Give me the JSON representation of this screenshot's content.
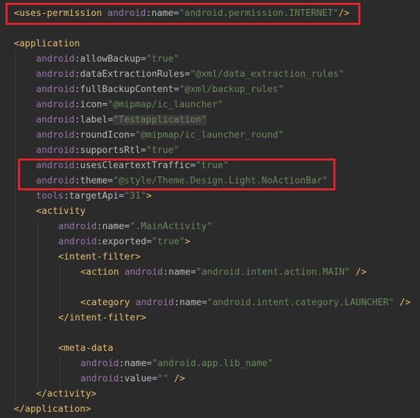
{
  "editor": {
    "highlight_color": "#e5232a",
    "lines": [
      {
        "indent": 0,
        "parts": [
          {
            "t": "<uses-permission",
            "c": "tag"
          },
          {
            "t": " ",
            "c": "punc"
          },
          {
            "t": "android",
            "c": "ns"
          },
          {
            "t": ":name",
            "c": "attr"
          },
          {
            "t": "=",
            "c": "punc"
          },
          {
            "t": "\"android.permission.INTERNET\"",
            "c": "val"
          },
          {
            "t": "/>",
            "c": "tag"
          }
        ]
      },
      {
        "indent": 0,
        "parts": []
      },
      {
        "indent": 0,
        "parts": [
          {
            "t": "<application",
            "c": "tag"
          }
        ]
      },
      {
        "indent": 1,
        "parts": [
          {
            "t": "android",
            "c": "ns"
          },
          {
            "t": ":allowBackup",
            "c": "attr"
          },
          {
            "t": "=",
            "c": "punc"
          },
          {
            "t": "\"true\"",
            "c": "val"
          }
        ]
      },
      {
        "indent": 1,
        "parts": [
          {
            "t": "android",
            "c": "ns"
          },
          {
            "t": ":dataExtractionRules",
            "c": "attr"
          },
          {
            "t": "=",
            "c": "punc"
          },
          {
            "t": "\"@xml/data_extraction_rules\"",
            "c": "val"
          }
        ]
      },
      {
        "indent": 1,
        "parts": [
          {
            "t": "android",
            "c": "ns"
          },
          {
            "t": ":fullBackupContent",
            "c": "attr"
          },
          {
            "t": "=",
            "c": "punc"
          },
          {
            "t": "\"@xml/backup_rules\"",
            "c": "val"
          }
        ]
      },
      {
        "indent": 1,
        "parts": [
          {
            "t": "android",
            "c": "ns"
          },
          {
            "t": ":icon",
            "c": "attr"
          },
          {
            "t": "=",
            "c": "punc"
          },
          {
            "t": "\"@mipmap/ic_launcher\"",
            "c": "val"
          }
        ]
      },
      {
        "indent": 1,
        "parts": [
          {
            "t": "android",
            "c": "ns"
          },
          {
            "t": ":label",
            "c": "attr"
          },
          {
            "t": "=",
            "c": "punc"
          },
          {
            "t": "\"Testapplication\"",
            "c": "val-sel"
          }
        ]
      },
      {
        "indent": 1,
        "parts": [
          {
            "t": "android",
            "c": "ns"
          },
          {
            "t": ":roundIcon",
            "c": "attr"
          },
          {
            "t": "=",
            "c": "punc"
          },
          {
            "t": "\"@mipmap/ic_launcher_round\"",
            "c": "val"
          }
        ]
      },
      {
        "indent": 1,
        "parts": [
          {
            "t": "android",
            "c": "ns"
          },
          {
            "t": ":supportsRtl",
            "c": "attr"
          },
          {
            "t": "=",
            "c": "punc"
          },
          {
            "t": "\"true\"",
            "c": "val"
          }
        ]
      },
      {
        "indent": 1,
        "parts": [
          {
            "t": "android",
            "c": "ns"
          },
          {
            "t": ":usesCleartextTraffic",
            "c": "attr"
          },
          {
            "t": "=",
            "c": "punc"
          },
          {
            "t": "\"true\"",
            "c": "val"
          }
        ]
      },
      {
        "indent": 1,
        "parts": [
          {
            "t": "android",
            "c": "ns"
          },
          {
            "t": ":theme",
            "c": "attr"
          },
          {
            "t": "=",
            "c": "punc"
          },
          {
            "t": "\"@style/Theme.Design.Light.NoActionBar\"",
            "c": "val"
          }
        ]
      },
      {
        "indent": 1,
        "parts": [
          {
            "t": "tools",
            "c": "ns"
          },
          {
            "t": ":targetApi",
            "c": "attr"
          },
          {
            "t": "=",
            "c": "punc"
          },
          {
            "t": "\"31\"",
            "c": "val"
          },
          {
            "t": ">",
            "c": "tag"
          }
        ]
      },
      {
        "indent": 1,
        "parts": [
          {
            "t": "<activity",
            "c": "tag"
          }
        ]
      },
      {
        "indent": 2,
        "parts": [
          {
            "t": "android",
            "c": "ns"
          },
          {
            "t": ":name",
            "c": "attr"
          },
          {
            "t": "=",
            "c": "punc"
          },
          {
            "t": "\".MainActivity\"",
            "c": "val"
          }
        ]
      },
      {
        "indent": 2,
        "parts": [
          {
            "t": "android",
            "c": "ns"
          },
          {
            "t": ":exported",
            "c": "attr"
          },
          {
            "t": "=",
            "c": "punc"
          },
          {
            "t": "\"true\"",
            "c": "val"
          },
          {
            "t": ">",
            "c": "tag"
          }
        ]
      },
      {
        "indent": 2,
        "parts": [
          {
            "t": "<intent-filter>",
            "c": "tag"
          }
        ]
      },
      {
        "indent": 3,
        "parts": [
          {
            "t": "<action",
            "c": "tag"
          },
          {
            "t": " ",
            "c": "punc"
          },
          {
            "t": "android",
            "c": "ns"
          },
          {
            "t": ":name",
            "c": "attr"
          },
          {
            "t": "=",
            "c": "punc"
          },
          {
            "t": "\"android.intent.action.MAIN\"",
            "c": "val"
          },
          {
            "t": " />",
            "c": "tag"
          }
        ]
      },
      {
        "indent": 0,
        "parts": []
      },
      {
        "indent": 3,
        "parts": [
          {
            "t": "<category",
            "c": "tag"
          },
          {
            "t": " ",
            "c": "punc"
          },
          {
            "t": "android",
            "c": "ns"
          },
          {
            "t": ":name",
            "c": "attr"
          },
          {
            "t": "=",
            "c": "punc"
          },
          {
            "t": "\"android.intent.category.LAUNCHER\"",
            "c": "val"
          },
          {
            "t": " />",
            "c": "tag"
          }
        ]
      },
      {
        "indent": 2,
        "parts": [
          {
            "t": "</intent-filter>",
            "c": "tag"
          }
        ]
      },
      {
        "indent": 0,
        "parts": []
      },
      {
        "indent": 2,
        "parts": [
          {
            "t": "<meta-data",
            "c": "tag"
          }
        ]
      },
      {
        "indent": 3,
        "parts": [
          {
            "t": "android",
            "c": "ns"
          },
          {
            "t": ":name",
            "c": "attr"
          },
          {
            "t": "=",
            "c": "punc"
          },
          {
            "t": "\"android.app.lib_name\"",
            "c": "val"
          }
        ]
      },
      {
        "indent": 3,
        "parts": [
          {
            "t": "android",
            "c": "ns"
          },
          {
            "t": ":value",
            "c": "attr"
          },
          {
            "t": "=",
            "c": "punc"
          },
          {
            "t": "\"\"",
            "c": "val"
          },
          {
            "t": " />",
            "c": "tag"
          }
        ]
      },
      {
        "indent": 1,
        "parts": [
          {
            "t": "</activity>",
            "c": "tag"
          }
        ]
      },
      {
        "indent": 0,
        "parts": [
          {
            "t": "</application>",
            "c": "tag"
          }
        ]
      }
    ]
  }
}
